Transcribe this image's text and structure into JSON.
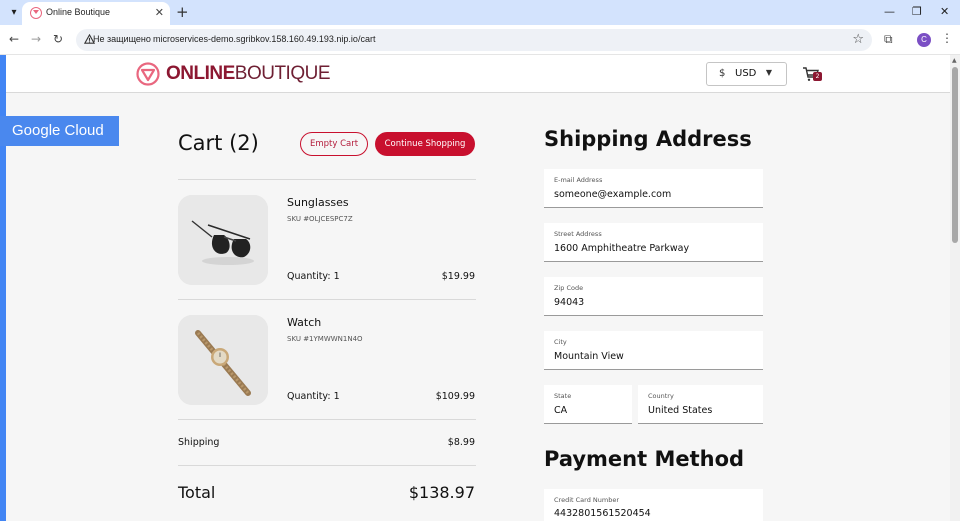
{
  "browser": {
    "tab_title": "Online Boutique",
    "new_tab": "+",
    "security_label": "Не защищено",
    "url": "microservices-demo.sgribkov.158.160.49.193.nip.io/cart",
    "profile_initial": "C"
  },
  "header": {
    "logo_bold": "ONLINE",
    "logo_light": "BOUTIQUE",
    "currency_symbol": "$",
    "currency_code": "USD",
    "cart_count": "2"
  },
  "banner": {
    "google_cloud": "Google Cloud"
  },
  "cart": {
    "title": "Cart (2)",
    "empty_button": "Empty Cart",
    "continue_button": "Continue Shopping",
    "items": [
      {
        "name": "Sunglasses",
        "sku": "SKU #OLJCESPC7Z",
        "quantity": "Quantity: 1",
        "price": "$19.99",
        "image": "sunglasses"
      },
      {
        "name": "Watch",
        "sku": "SKU #1YMWWN1N4O",
        "quantity": "Quantity: 1",
        "price": "$109.99",
        "image": "watch"
      }
    ],
    "shipping_label": "Shipping",
    "shipping_price": "$8.99",
    "total_label": "Total",
    "total_price": "$138.97"
  },
  "shipping_address": {
    "title": "Shipping Address",
    "email_label": "E-mail Address",
    "email_value": "someone@example.com",
    "street_label": "Street Address",
    "street_value": "1600 Amphitheatre Parkway",
    "zip_label": "Zip Code",
    "zip_value": "94043",
    "city_label": "City",
    "city_value": "Mountain View",
    "state_label": "State",
    "state_value": "CA",
    "country_label": "Country",
    "country_value": "United States"
  },
  "payment": {
    "title": "Payment Method",
    "card_label": "Credit Card Number",
    "card_value": "4432801561520454"
  },
  "colors": {
    "brand": "#c8102e",
    "google_blue": "#4a88ee",
    "tab_strip": "#d3e3fd"
  }
}
